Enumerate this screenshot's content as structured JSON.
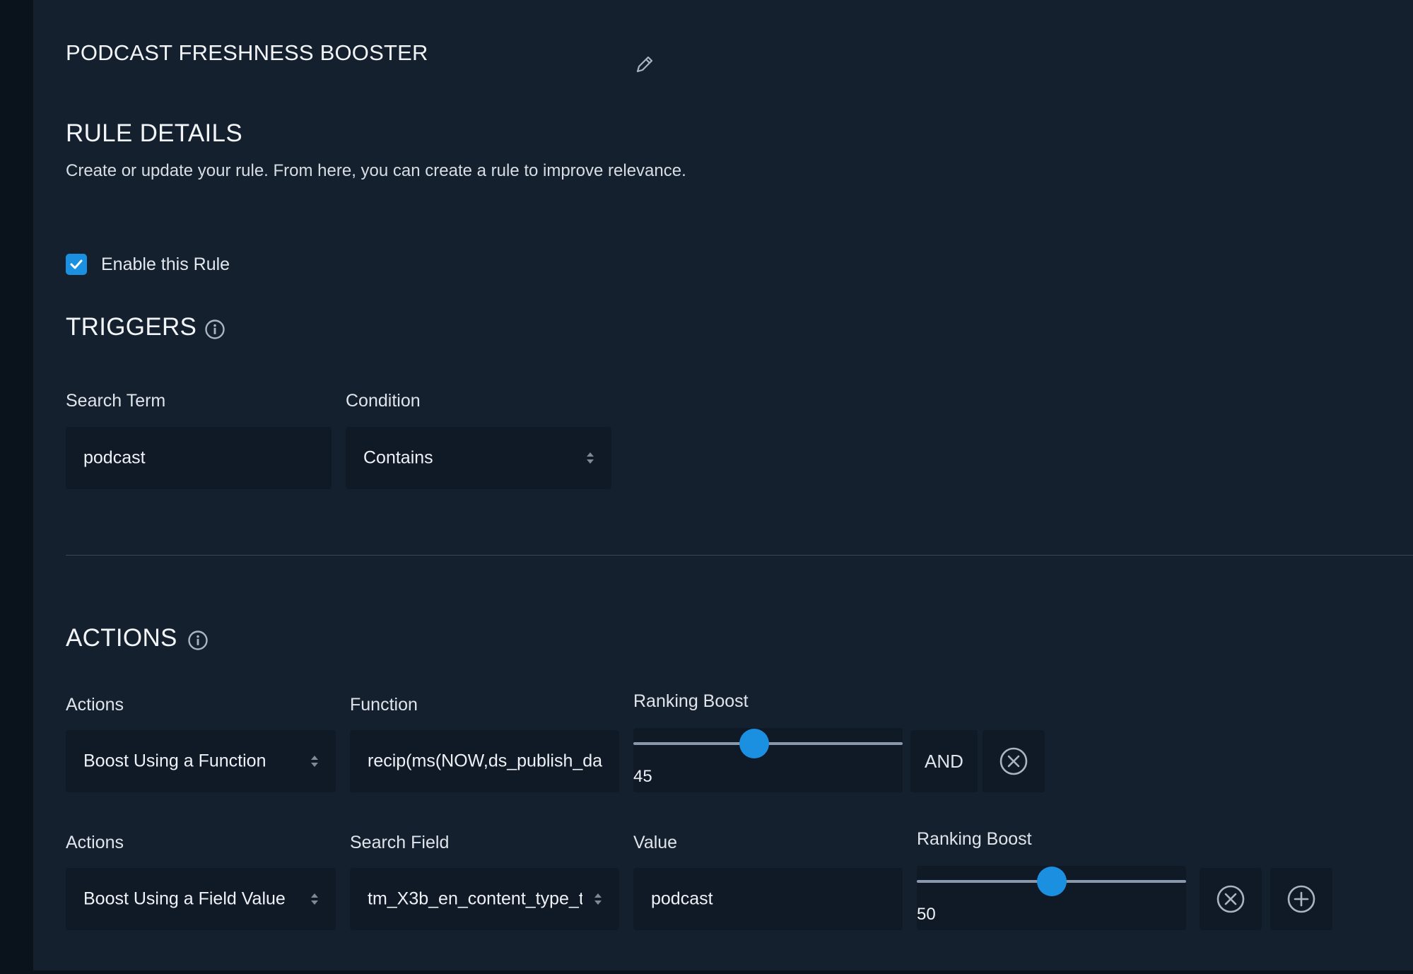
{
  "rule": {
    "name": "PODCAST FRESHNESS BOOSTER"
  },
  "details": {
    "title": "RULE DETAILS",
    "description": "Create or update your rule. From here, you can create a rule to improve relevance.",
    "enable_label": "Enable this Rule",
    "enabled": true
  },
  "triggers": {
    "title": "TRIGGERS",
    "search_term_label": "Search Term",
    "search_term_value": "podcast",
    "condition_label": "Condition",
    "condition_value": "Contains"
  },
  "actions": {
    "title": "ACTIONS",
    "row1": {
      "action_label": "Actions",
      "action_value": "Boost Using a Function",
      "function_label": "Function",
      "function_value": "recip(ms(NOW,ds_publish_da",
      "boost_label": "Ranking Boost",
      "boost_value": 45,
      "boost_max": 100,
      "joiner": "AND"
    },
    "row2": {
      "action_label": "Actions",
      "action_value": "Boost Using a Field Value",
      "field_label": "Search Field",
      "field_value": "tm_X3b_en_content_type_t",
      "value_label": "Value",
      "value_value": "podcast",
      "boost_label": "Ranking Boost",
      "boost_value": 50,
      "boost_max": 100
    }
  },
  "colors": {
    "accent": "#1b8fe0",
    "background": "#15202f",
    "field": "#101a27"
  }
}
